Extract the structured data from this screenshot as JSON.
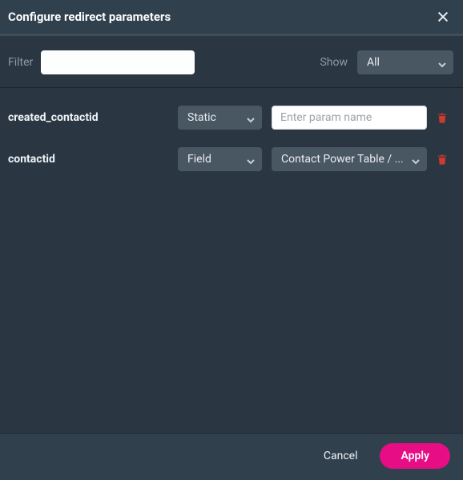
{
  "title": "Configure redirect parameters",
  "filter": {
    "label": "Filter",
    "value": ""
  },
  "show": {
    "label": "Show",
    "selected": "All"
  },
  "rows": [
    {
      "name": "created_contactid",
      "type_selected": "Static",
      "value_mode": "input",
      "value": "",
      "placeholder": "Enter param name"
    },
    {
      "name": "contactid",
      "type_selected": "Field",
      "value_mode": "select",
      "value": "Contact Power Table / ..."
    }
  ],
  "buttons": {
    "cancel": "Cancel",
    "apply": "Apply"
  }
}
